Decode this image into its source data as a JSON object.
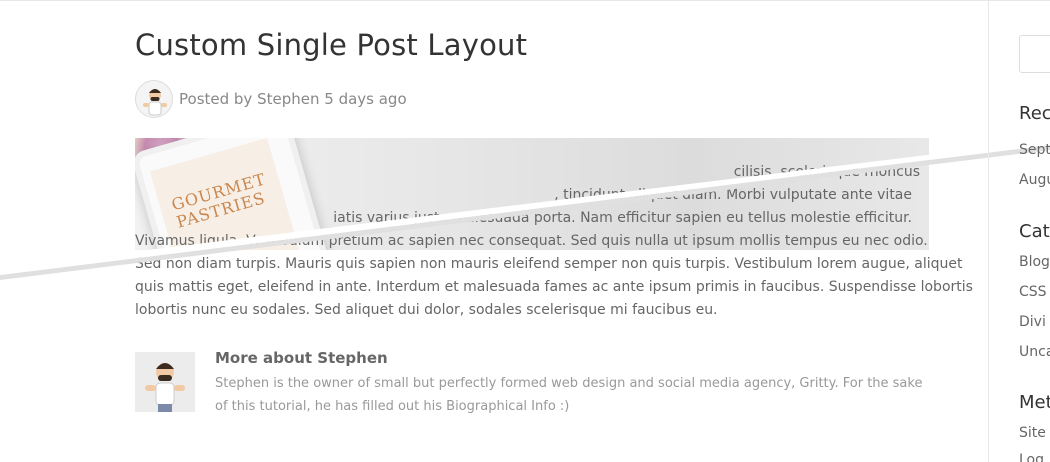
{
  "post": {
    "title": "Custom Single Post Layout",
    "meta_prefix": "Posted by ",
    "author": "Stephen",
    "date": " 5 days ago"
  },
  "hero": {
    "image_text_line1": "GOURMET",
    "image_text_line2": "PASTRIES"
  },
  "body_lines": [
    "cilisis, scelerisque rhoncus",
    ", tincidunt aliquet diam. Morbi vulputate ante vitae",
    "iatis varius justo malesuada porta. Nam efficitur sapien eu tellus molestie efficitur.",
    "Vivamus ligula. Vestibulum pretium ac sapien nec consequat. Sed quis nulla ut ipsum mollis tempus eu nec odio.",
    "Sed non diam turpis. Mauris quis sapien non mauris eleifend semper non quis turpis. Vestibulum lorem augue, aliquet",
    "quis mattis eget, eleifend in ante. Interdum et malesuada fames ac ante ipsum primis in faucibus. Suspendisse lobortis",
    "lobortis nunc eu sodales. Sed aliquet dui dolor, sodales scelerisque mi faucibus eu."
  ],
  "author_box": {
    "heading": "More about Stephen",
    "bio": "Stephen is the owner of small but perfectly formed web design and social media agency, Gritty. For the sake of this tutorial, he has filled out his Biographical Info :)"
  },
  "sidebar": {
    "recent_title": "Rec",
    "recent_items": [
      "Septe",
      "Augu"
    ],
    "categories_title": "Cate",
    "categories": [
      "Blog",
      "CSS",
      "Divi",
      "Unca"
    ],
    "meta_title": "Met",
    "meta_items": [
      "Site",
      "Log"
    ]
  }
}
